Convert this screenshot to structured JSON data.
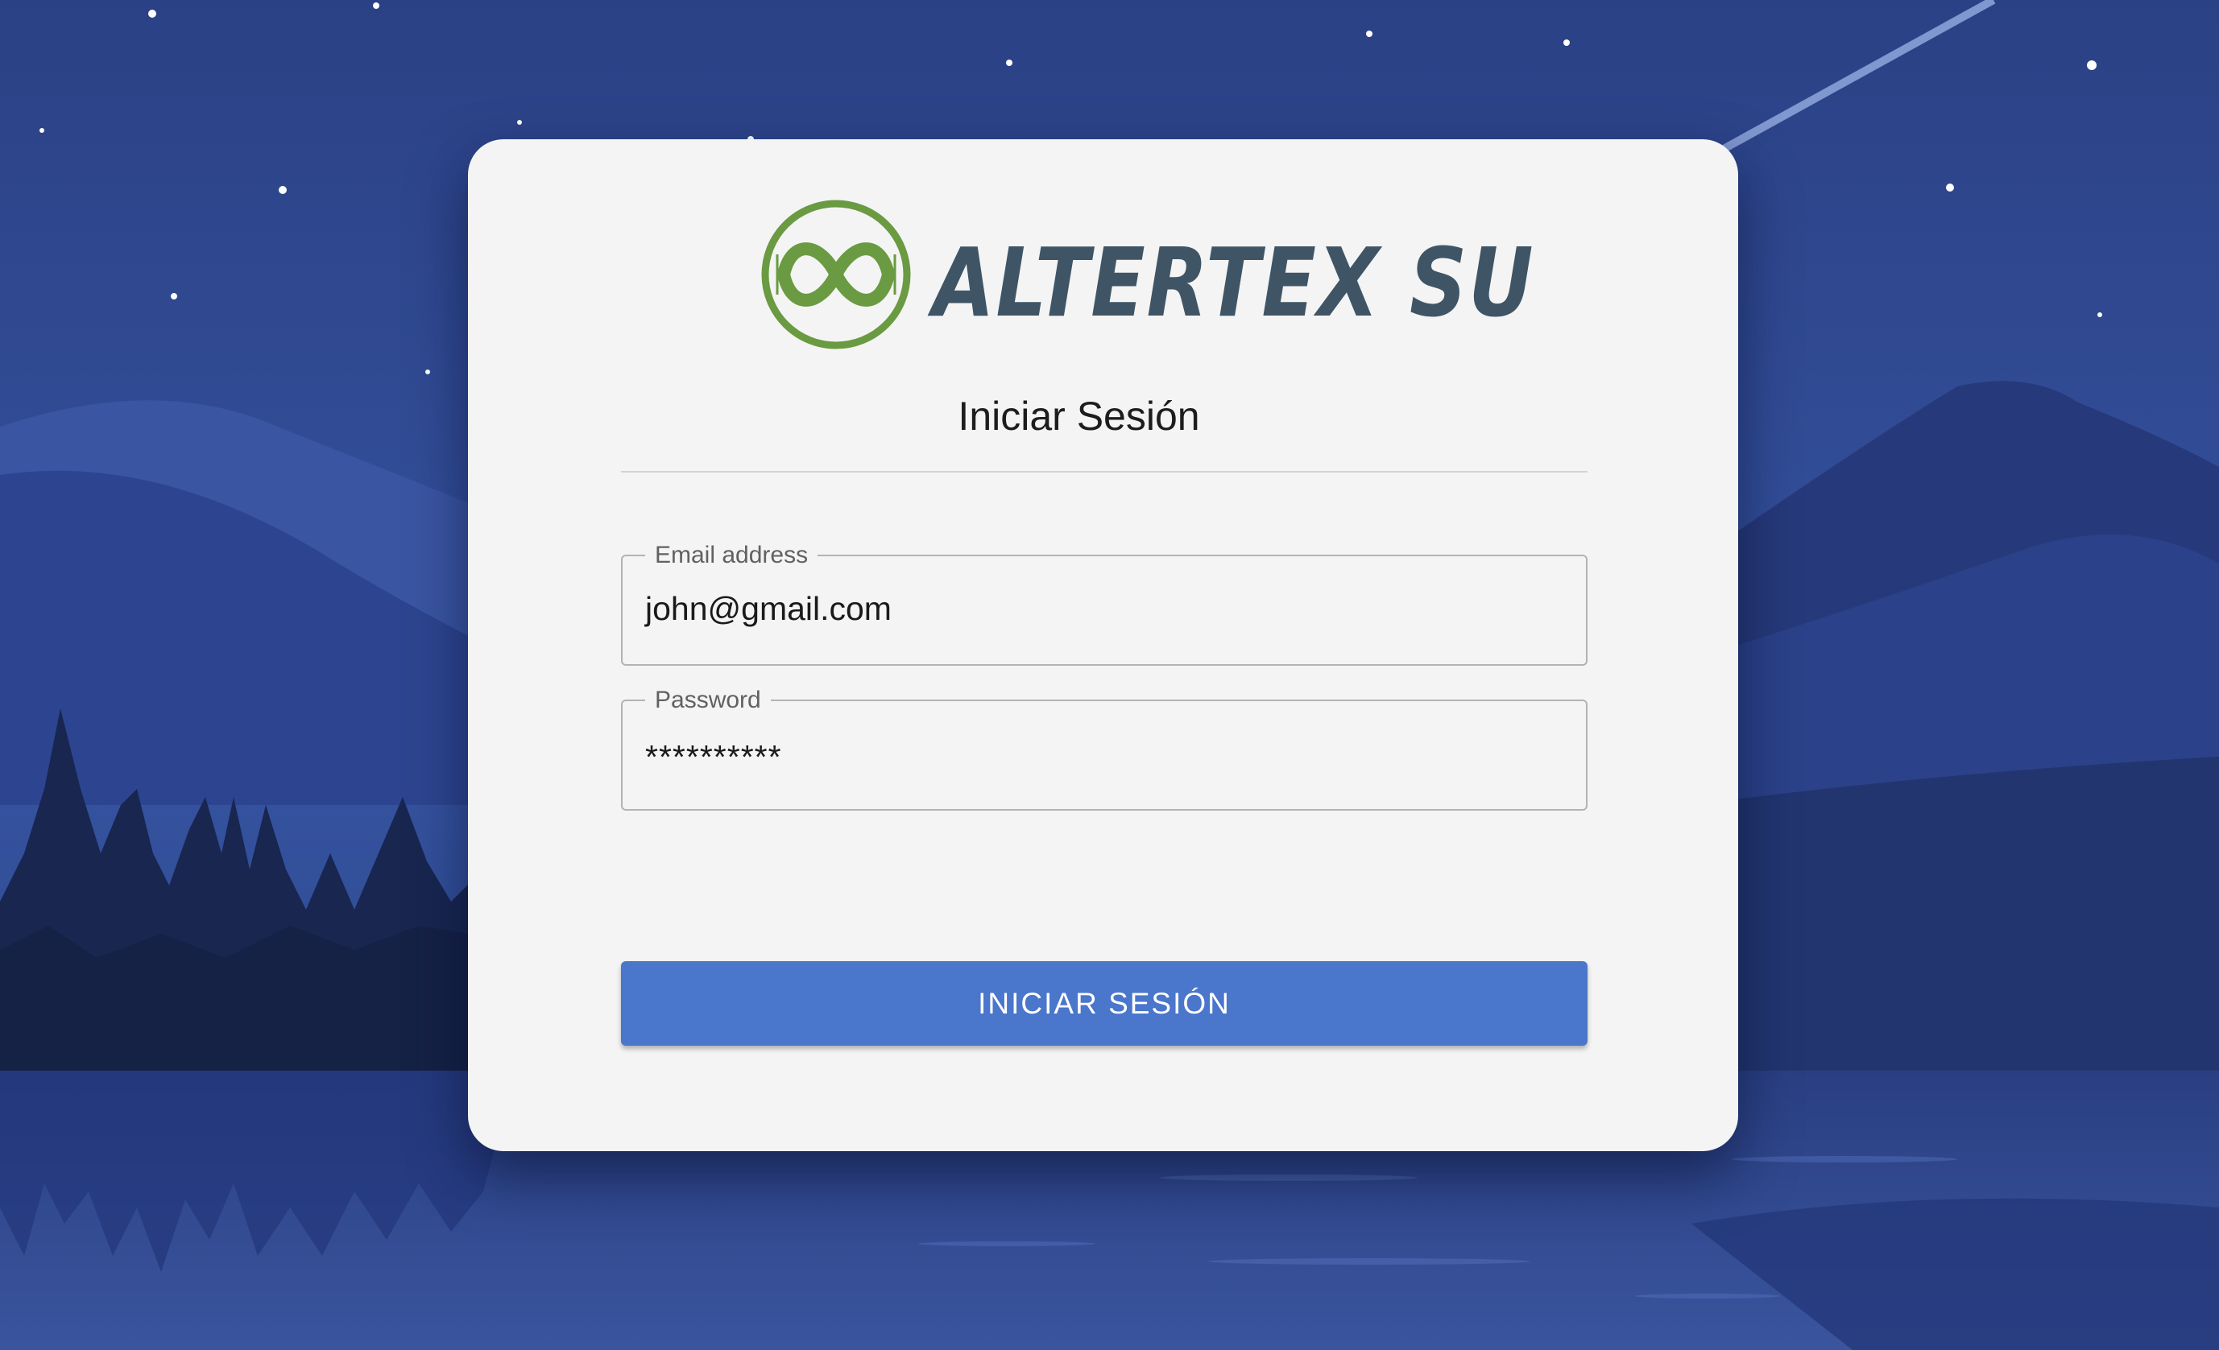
{
  "brand": {
    "name": "ALTERTEX SU",
    "logo_icon": "infinity-circle-logo",
    "logo_color": "#6a9a41",
    "text_color": "#3f5566"
  },
  "login": {
    "title": "Iniciar Sesión",
    "email": {
      "label": "Email address",
      "value": "john@gmail.com"
    },
    "password": {
      "label": "Password",
      "value": "**********"
    },
    "submit_label": "INICIAR SESIÓN"
  },
  "colors": {
    "background": "#2d4385",
    "card": "#f4f4f4",
    "button": "#4a76cb"
  }
}
